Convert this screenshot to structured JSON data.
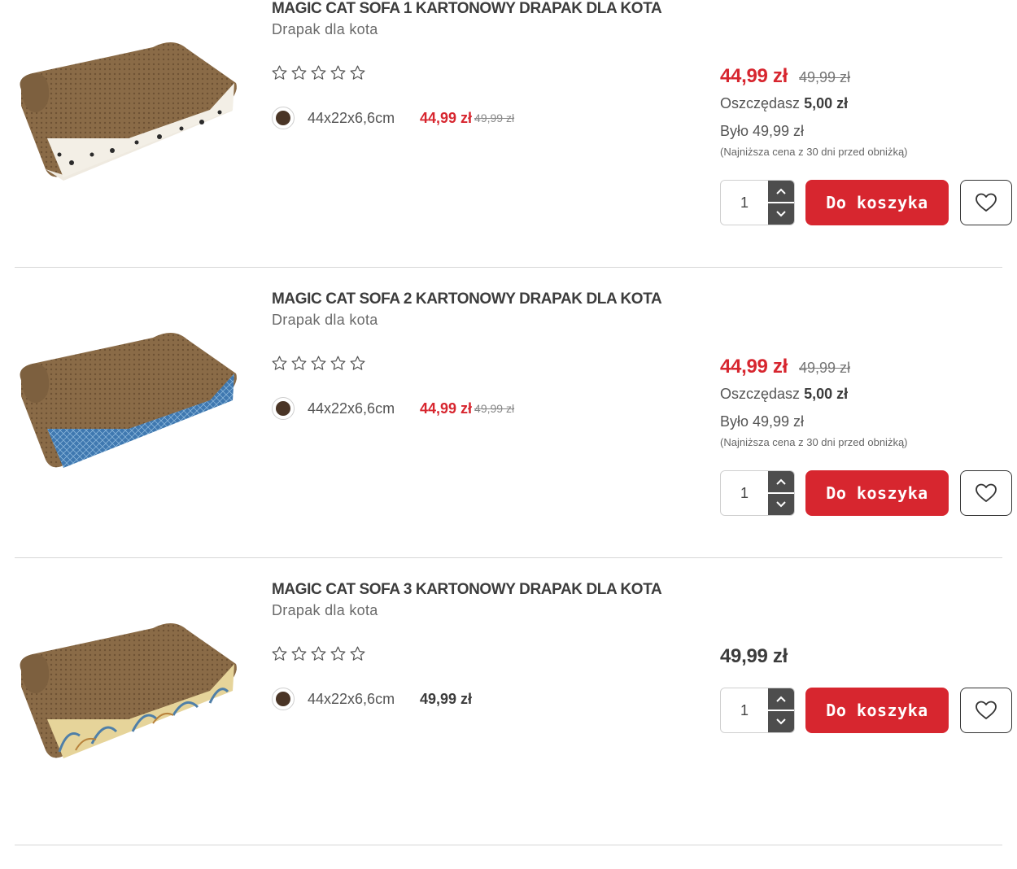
{
  "products": [
    {
      "title": "MAGIC CAT SOFA 1 KARTONOWY DRAPAK DLA KOTA",
      "subtitle": "Drapak dla kota",
      "rating": 0,
      "variant": {
        "size": "44x22x6,6cm",
        "price": "44,99 zł",
        "old_price": "49,99 zł",
        "color": "#4a3526"
      },
      "price": "44,99 zł",
      "old_price": "49,99 zł",
      "save_label": "Oszczędasz",
      "save_value": "5,00 zł",
      "was": "Było 49,99 zł",
      "lowest_note": "(Najniższa cena z 30 dni przed obniżką)",
      "quantity": "1",
      "cart_label": "Do koszyka",
      "image_icon": "cat-scratcher-sofa-dots"
    },
    {
      "title": "MAGIC CAT SOFA 2 KARTONOWY DRAPAK DLA KOTA",
      "subtitle": "Drapak dla kota",
      "rating": 0,
      "variant": {
        "size": "44x22x6,6cm",
        "price": "44,99 zł",
        "old_price": "49,99 zł",
        "color": "#4a3526"
      },
      "price": "44,99 zł",
      "old_price": "49,99 zł",
      "save_label": "Oszczędasz",
      "save_value": "5,00 zł",
      "was": "Było 49,99 zł",
      "lowest_note": "(Najniższa cena z 30 dni przed obniżką)",
      "quantity": "1",
      "cart_label": "Do koszyka",
      "image_icon": "cat-scratcher-sofa-blue"
    },
    {
      "title": "MAGIC CAT SOFA 3 KARTONOWY DRAPAK DLA KOTA",
      "subtitle": "Drapak dla kota",
      "rating": 0,
      "variant": {
        "size": "44x22x6,6cm",
        "price": "49,99 zł",
        "color": "#4a3526"
      },
      "price": "49,99 zł",
      "quantity": "1",
      "cart_label": "Do koszyka",
      "image_icon": "cat-scratcher-sofa-leaves"
    }
  ],
  "colors": {
    "accent": "#d7262f",
    "text": "#3c3c3c",
    "stepper": "#4d4d4d"
  }
}
